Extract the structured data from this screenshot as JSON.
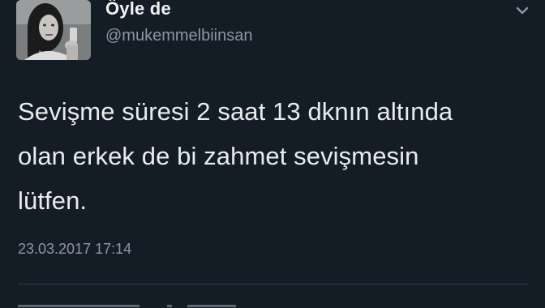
{
  "tweet": {
    "display_name": "Öyle de",
    "handle": "@mukemmelbiinsan",
    "text_lines": [
      "Sevişme süresi 2 saat 13 dknın altında",
      "olan erkek de bi zahmet sevişmesin",
      "lütfen."
    ],
    "timestamp": "23.03.2017 17:14",
    "avatar_icon": "profile-photo",
    "menu_icon": "chevron-down-icon"
  },
  "colors": {
    "background": "#141d26",
    "text": "#e6ecf0",
    "muted": "#8b98a5"
  }
}
